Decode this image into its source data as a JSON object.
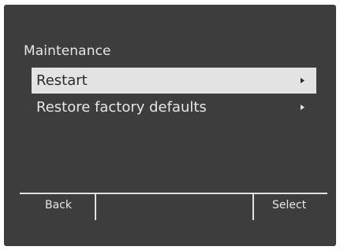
{
  "screen": {
    "title": "Maintenance",
    "background_color": "#3d3d3d",
    "highlight_color": "#e3e3e3"
  },
  "menu": {
    "items": [
      {
        "label": "Restart",
        "selected": true,
        "icon": "chevron-right-icon"
      },
      {
        "label": "Restore factory defaults",
        "selected": false,
        "icon": "chevron-right-icon"
      }
    ]
  },
  "softkeys": {
    "left_label": "Back",
    "middle_label": "",
    "right_label": "Select"
  }
}
